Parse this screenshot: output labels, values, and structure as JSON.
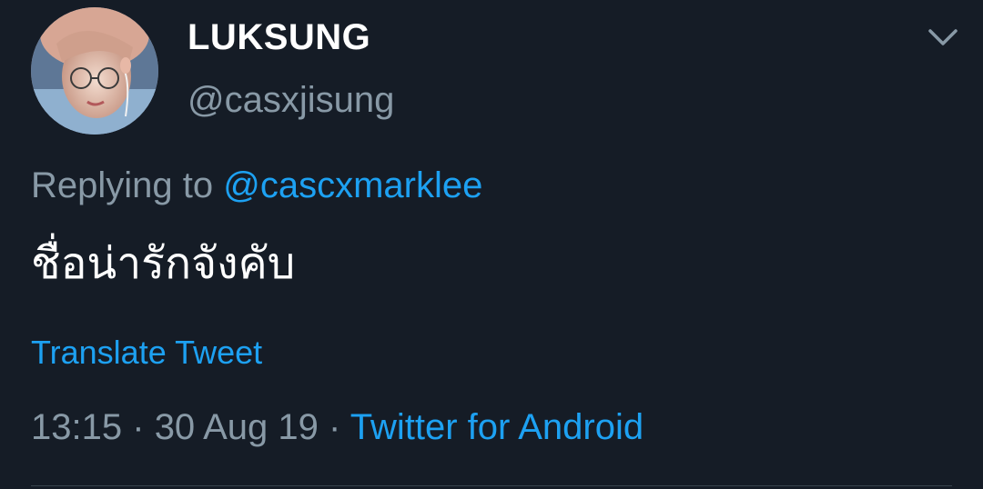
{
  "tweet": {
    "display_name": "LUKSUNG",
    "handle": "@casxjisung",
    "replying_to_prefix": "Replying to",
    "replying_to_handle": "@cascxmarklee",
    "text": "ชื่อน่ารักจังคับ",
    "translate_label": "Translate Tweet",
    "time": "13:15",
    "date": "30 Aug 19",
    "separator": "·",
    "source": "Twitter for Android"
  },
  "icons": {
    "menu": "chevron-down-icon"
  },
  "colors": {
    "background": "#151c26",
    "primary_text": "#ffffff",
    "secondary_text": "#8899a6",
    "link": "#1da1f2"
  }
}
